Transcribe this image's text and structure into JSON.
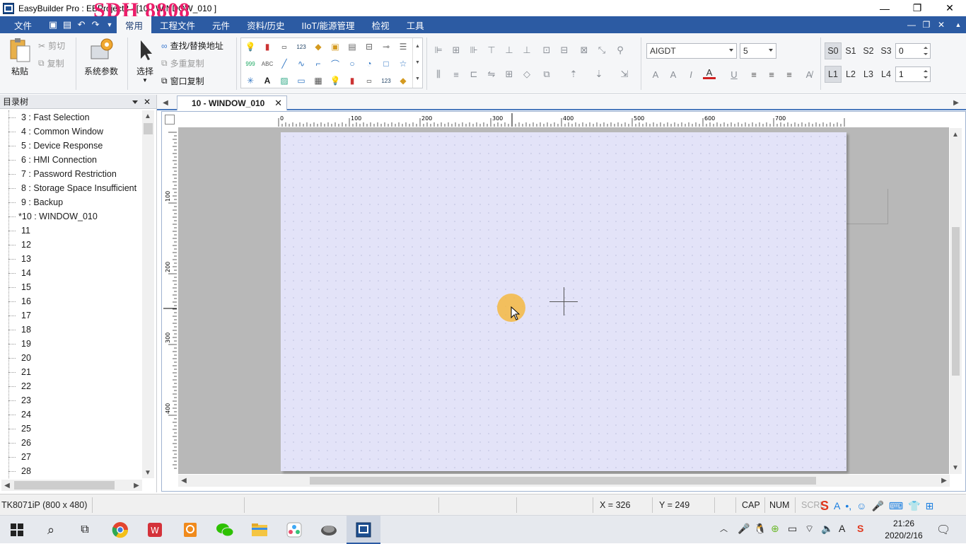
{
  "titlebar": {
    "title": "EasyBuilder Pro : EBProject2 - [10 - WINDOW_010 ]",
    "watermark": "SDH 8808",
    "minimize": "—",
    "maximize": "❐",
    "close": "✕"
  },
  "menubar": {
    "file": "文件",
    "items": [
      "常用",
      "工程文件",
      "元件",
      "资料/历史",
      "IIoT/能源管理",
      "检视",
      "工具"
    ],
    "mdi_min": "—",
    "mdi_restore": "❐",
    "mdi_close": "✕"
  },
  "ribbon": {
    "paste": "粘贴",
    "cut": "剪切",
    "copy": "复制",
    "system_params": "系统参数",
    "select": "选择",
    "find_replace": "查找/替换地址",
    "multi_copy": "多重复制",
    "window_copy": "窗口复制",
    "font_name": "AIGDT",
    "font_size": "5",
    "layers_s": [
      "S0",
      "S1",
      "S2",
      "S3"
    ],
    "layers_l": [
      "L1",
      "L2",
      "L3",
      "L4"
    ],
    "s_value": "0",
    "l_value": "1"
  },
  "tree": {
    "header": "目录树",
    "items": [
      "3 : Fast Selection",
      "4 : Common Window",
      "5 : Device Response",
      "6 : HMI Connection",
      "7 : Password Restriction",
      "8 : Storage Space Insufficient",
      "9 : Backup",
      "*10 : WINDOW_010",
      "11",
      "12",
      "13",
      "14",
      "15",
      "16",
      "17",
      "18",
      "19",
      "20",
      "21",
      "22",
      "23",
      "24",
      "25",
      "26",
      "27",
      "28"
    ]
  },
  "document": {
    "tab_label": "10 - WINDOW_010",
    "ruler_top_labels": [
      "0",
      "100",
      "200",
      "300",
      "400",
      "500",
      "600",
      "700"
    ],
    "ruler_left_labels": [
      "100",
      "200",
      "300",
      "400"
    ]
  },
  "status": {
    "model": "TK8071iP (800 x 480)",
    "x": "X = 326",
    "y": "Y = 249",
    "cap": "CAP",
    "num": "NUM",
    "scrl": "SCRL"
  },
  "taskbar": {
    "time": "21:26",
    "date": "2020/2/16",
    "ime": "A"
  },
  "colors": {
    "menubar": "#2c5ba3",
    "canvas": "#e3e3f8",
    "workspace": "#b8b8b8",
    "click_indicator": "#f4b842"
  }
}
